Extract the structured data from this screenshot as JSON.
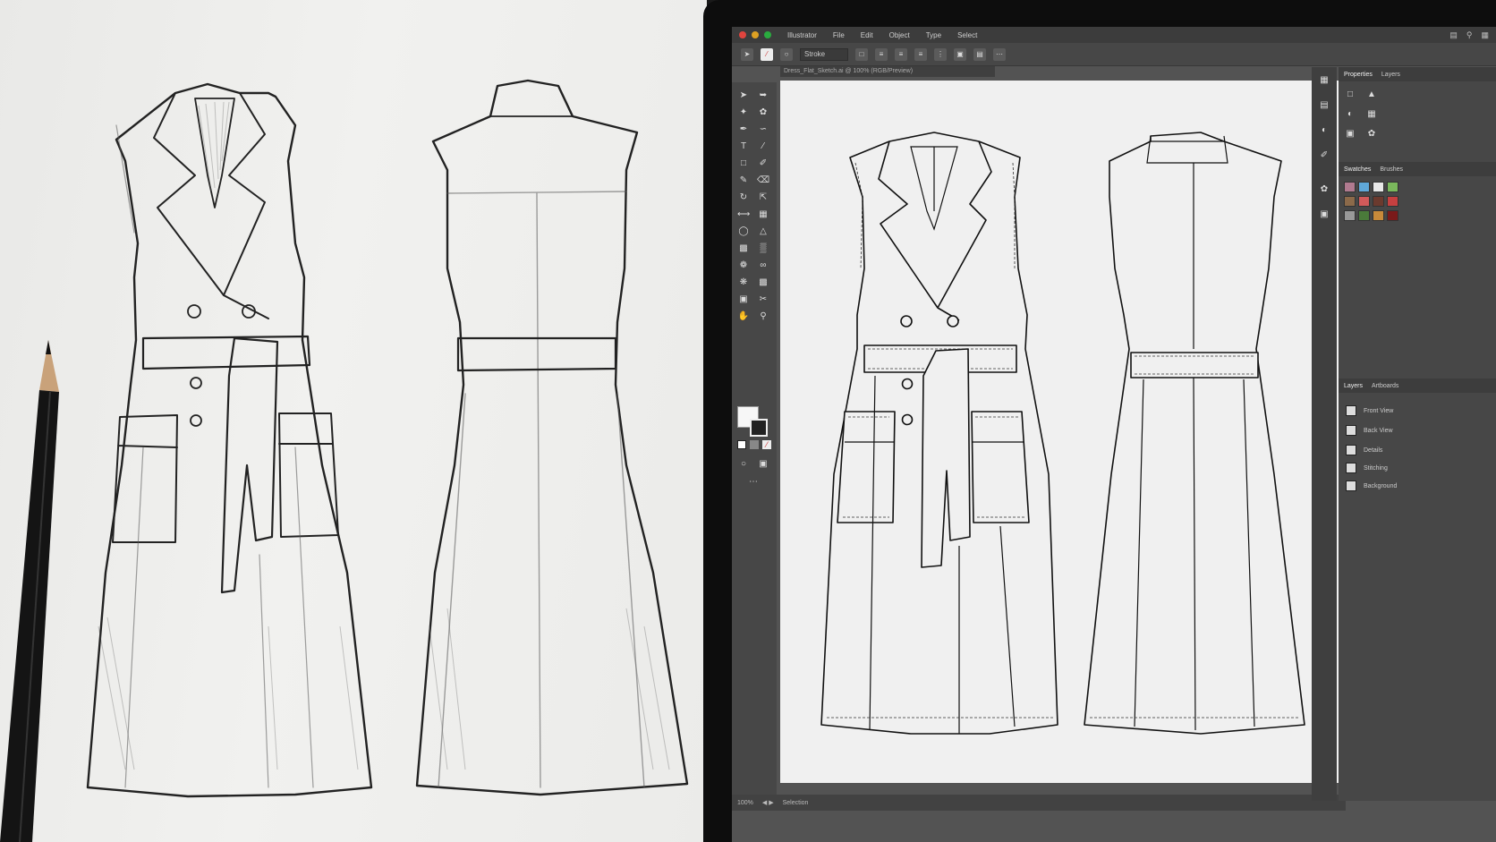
{
  "app": {
    "menu": [
      "Illustrator",
      "File",
      "Edit",
      "Object",
      "Type",
      "Select"
    ],
    "option_bar": {
      "stroke_label": "Stroke"
    },
    "document_tab": "Dress_Flat_Sketch.ai @ 100% (RGB/Preview)",
    "status_zoom": "100%",
    "status_tool": "Selection"
  },
  "panels": {
    "tabs_top": [
      "Properties",
      "Layers"
    ],
    "tabs_swatches": [
      "Swatches",
      "Brushes"
    ],
    "tabs_layers": [
      "Layers",
      "Artboards"
    ],
    "layers": [
      "Front View",
      "Back View",
      "Details",
      "Stitching",
      "Background"
    ]
  },
  "colors": {
    "swatches": [
      "#b07a8f",
      "#5fa8d9",
      "#e8e8e8",
      "#7ab85c",
      "#8c6a4a",
      "#d15a5a",
      "#6b3a2e",
      "#c64040",
      "#999999",
      "#4a7a3a",
      "#c88a3a",
      "#7a1a1a"
    ]
  },
  "icons": [
    "selection-icon",
    "direct-selection-icon",
    "pen-icon",
    "pencil-icon",
    "brush-icon",
    "zoom-icon",
    "hand-icon",
    "eraser-icon",
    "shape-icon",
    "text-icon"
  ]
}
